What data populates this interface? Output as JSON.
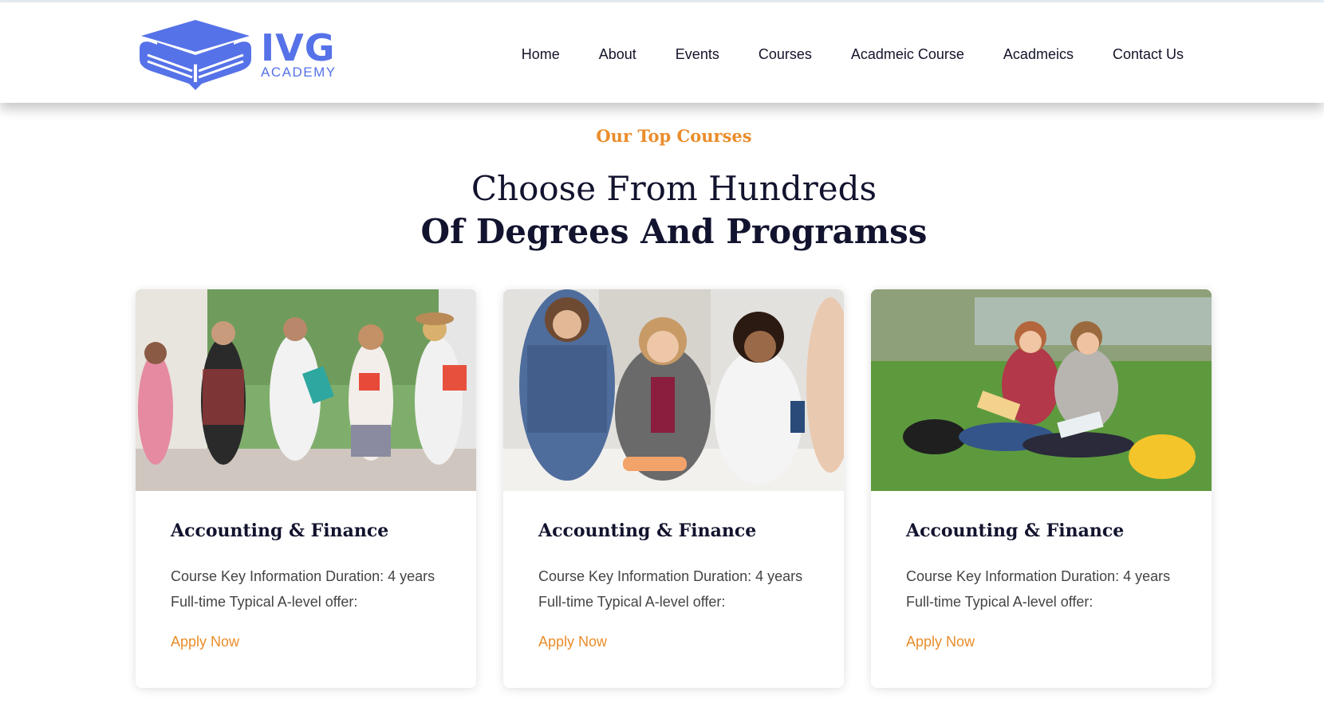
{
  "header": {
    "logo": {
      "word": "IVG",
      "sub": "ACADEMY",
      "color": "#5672e8"
    },
    "nav": [
      {
        "label": "Home"
      },
      {
        "label": "About"
      },
      {
        "label": "Events"
      },
      {
        "label": "Courses"
      },
      {
        "label": "Acadmeic Course"
      },
      {
        "label": "Acadmeics"
      },
      {
        "label": "Contact Us"
      }
    ]
  },
  "section": {
    "eyebrow": "Our Top Courses",
    "headline_line1": "Choose From Hundreds",
    "headline_line2": "Of Degrees And Programss"
  },
  "courses": [
    {
      "title": "Accounting & Finance",
      "desc_line1": "Course Key Information Duration: 4 years",
      "desc_line2": "Full-time Typical A-level offer:",
      "cta": "Apply Now"
    },
    {
      "title": "Accounting & Finance",
      "desc_line1": "Course Key Information Duration: 4 years",
      "desc_line2": "Full-time Typical A-level offer:",
      "cta": "Apply Now"
    },
    {
      "title": "Accounting & Finance",
      "desc_line1": "Course Key Information Duration: 4 years",
      "desc_line2": "Full-time Typical A-level offer:",
      "cta": "Apply Now"
    }
  ],
  "colors": {
    "accent": "#ea8d2b",
    "heading": "#12132e",
    "brand": "#5672e8"
  }
}
